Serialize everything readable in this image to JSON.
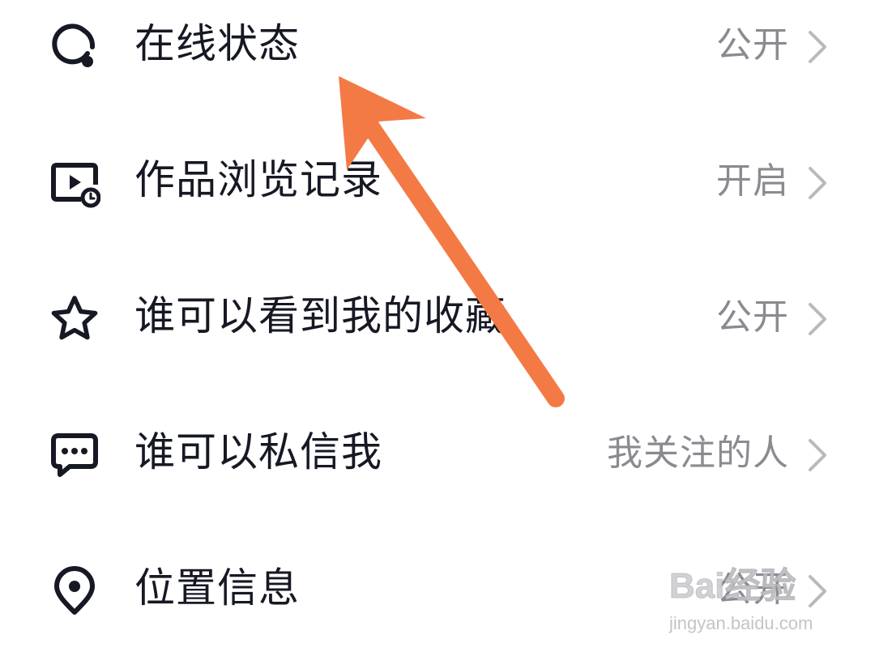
{
  "privacy_settings": {
    "items": [
      {
        "label": "在线状态",
        "value": "公开",
        "icon": "online-status-icon"
      },
      {
        "label": "作品浏览记录",
        "value": "开启",
        "icon": "video-history-icon"
      },
      {
        "label": "谁可以看到我的收藏",
        "value": "公开",
        "icon": "star-icon"
      },
      {
        "label": "谁可以私信我",
        "value": "我关注的人",
        "icon": "message-icon"
      },
      {
        "label": "位置信息",
        "value": "公开",
        "icon": "location-pin-icon"
      }
    ]
  },
  "annotation": {
    "arrow_color": "#f47a45"
  },
  "watermark": {
    "brand": "Bai经验",
    "url": "jingyan.baidu.com"
  }
}
